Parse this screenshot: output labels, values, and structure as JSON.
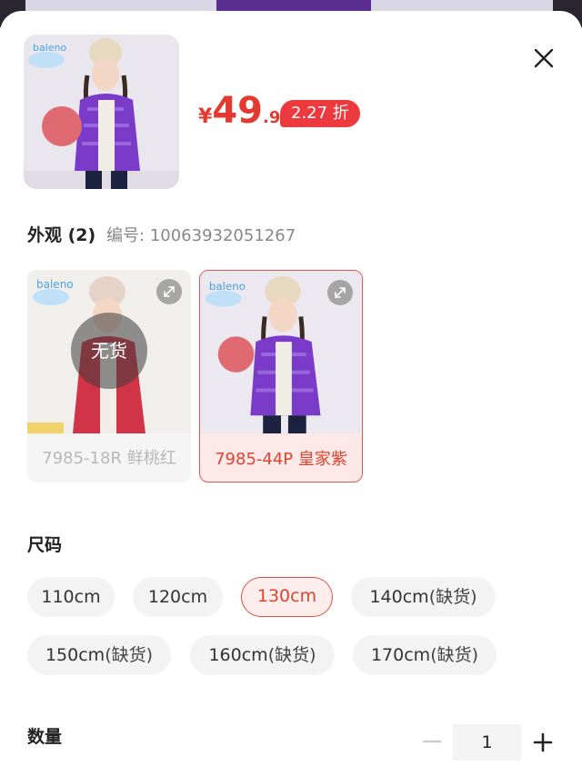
{
  "product": {
    "price_currency": "¥",
    "price_integer": "49",
    "price_decimal": ".9",
    "discount_badge": "2.27 折",
    "thumbnail_icon": "girl-purple-jacket-photo"
  },
  "appearance": {
    "title": "外观 (2)",
    "code_label": "编号:",
    "code_value": "10063932051267",
    "options": [
      {
        "label": "7985-18R 鲜桃红",
        "status": "无货",
        "selected": false,
        "color": "#d8354a"
      },
      {
        "label": "7985-44P 皇家紫",
        "status": "",
        "selected": true,
        "color": "#7c3fc4"
      }
    ]
  },
  "size": {
    "title": "尺码",
    "options": [
      {
        "label": "110cm",
        "suffix": "",
        "selected": false
      },
      {
        "label": "120cm",
        "suffix": "",
        "selected": false
      },
      {
        "label": "130cm",
        "suffix": "",
        "selected": true
      },
      {
        "label": "140cm",
        "suffix": "(缺货)",
        "selected": false
      },
      {
        "label": "150cm",
        "suffix": "(缺货)",
        "selected": false
      },
      {
        "label": "160cm",
        "suffix": "(缺货)",
        "selected": false
      },
      {
        "label": "170cm",
        "suffix": "(缺货)",
        "selected": false
      }
    ]
  },
  "quantity": {
    "title": "数量",
    "value": "1"
  },
  "colors": {
    "accent": "#e23a2e",
    "badge": "#ec3a3f"
  }
}
